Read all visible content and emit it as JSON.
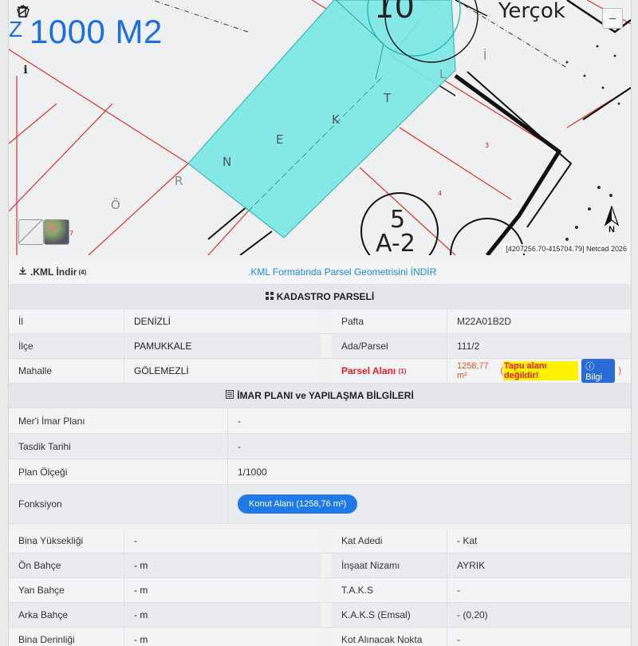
{
  "map": {
    "scale_text": "1000 M2",
    "zoom_label": "–",
    "north_label": "N",
    "coords_text": "[4207256.70-415704.79] Netcad 2026",
    "labels": {
      "street_letters": [
        "Ö",
        "R",
        "N",
        "E",
        "K",
        "T",
        "L",
        "İ"
      ],
      "block_top": "10",
      "block_name": "Yerçok",
      "block_num_top": "5",
      "block_num_bottom": "A-2",
      "parcel_3": "3",
      "parcel_4": "4",
      "parcel_7": "7"
    },
    "tools": [
      "draw-line-icon",
      "polygon-icon",
      "trash-icon",
      "info-icon"
    ],
    "parcel_fill_color": "#7fe9e6"
  },
  "kml": {
    "label": ".KML İndir",
    "sup": "(4)",
    "link_text": ".KML Formatında Parsel Geometrisini İNDİR"
  },
  "kadastro": {
    "title": "KADASTRO PARSELİ",
    "rows": [
      {
        "l1": "İl",
        "v1": "DENİZLİ",
        "l2": "Pafta",
        "v2": "M22A01B2D"
      },
      {
        "l1": "İlçe",
        "v1": "PAMUKKALE",
        "l2": "Ada/Parsel",
        "v2": "111/2"
      },
      {
        "l1": "Mahalle",
        "v1": "GÖLEMEZLİ",
        "l2": "Parsel Alanı",
        "l2_sup": "(1)",
        "v2": "1258,77 m²",
        "note_open": "(",
        "note": "Tapu alanı değildir!",
        "bilgi": "Bilgi",
        "note_close": ")"
      }
    ]
  },
  "imar": {
    "title": "İMAR PLANI ve YAPILAŞMA BİLGİLERİ",
    "plan_rows": [
      {
        "label": "Mer'i İmar Planı",
        "value": "-"
      },
      {
        "label": "Tasdik Tarihi",
        "value": "-"
      },
      {
        "label": "Plan Ölçeği",
        "value": "1/1000"
      }
    ],
    "fonksiyon": {
      "label": "Fonksiyon",
      "value": "Konut Alanı (1258,76 m²)"
    },
    "rows": [
      {
        "l1": "Bina Yüksekliği",
        "v1": "-",
        "l2": "Kat Adedi",
        "v2": "- Kat"
      },
      {
        "l1": "Ön Bahçe",
        "v1": "- m",
        "l2": "İnşaat Nizamı",
        "v2": "AYRIK"
      },
      {
        "l1": "Yan Bahçe",
        "v1": "- m",
        "l2": "T.A.K.S",
        "v2": "-"
      },
      {
        "l1": "Arka Bahçe",
        "v1": "- m",
        "l2": "K.A.K.S (Emsal)",
        "v2": "- (0,20)"
      },
      {
        "l1": "Bina Derinliği",
        "v1": "- m",
        "l2": "Kot Alınacak Nokta",
        "v2": "-"
      }
    ]
  }
}
